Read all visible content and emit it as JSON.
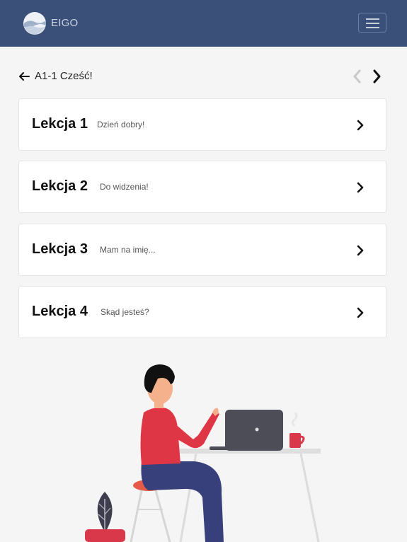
{
  "navbar": {
    "brand": "EIGO",
    "menu_icon": "hamburger-icon",
    "color": "#3b5078"
  },
  "header": {
    "back_icon": "arrow-left-icon",
    "title": "A1-1 Cześć!",
    "prev_icon": "chevron-left-icon",
    "next_icon": "chevron-right-icon"
  },
  "lessons": [
    {
      "title": "Lekcja 1",
      "subtitle": "Dzień dobry!"
    },
    {
      "title": "Lekcja 2",
      "subtitle": "Do widzenia!"
    },
    {
      "title": "Lekcja 3",
      "subtitle": "Mam na imię..."
    },
    {
      "title": "Lekcja 4",
      "subtitle": "Skąd jesteś?"
    }
  ],
  "illustration": "person-at-laptop-illustration"
}
